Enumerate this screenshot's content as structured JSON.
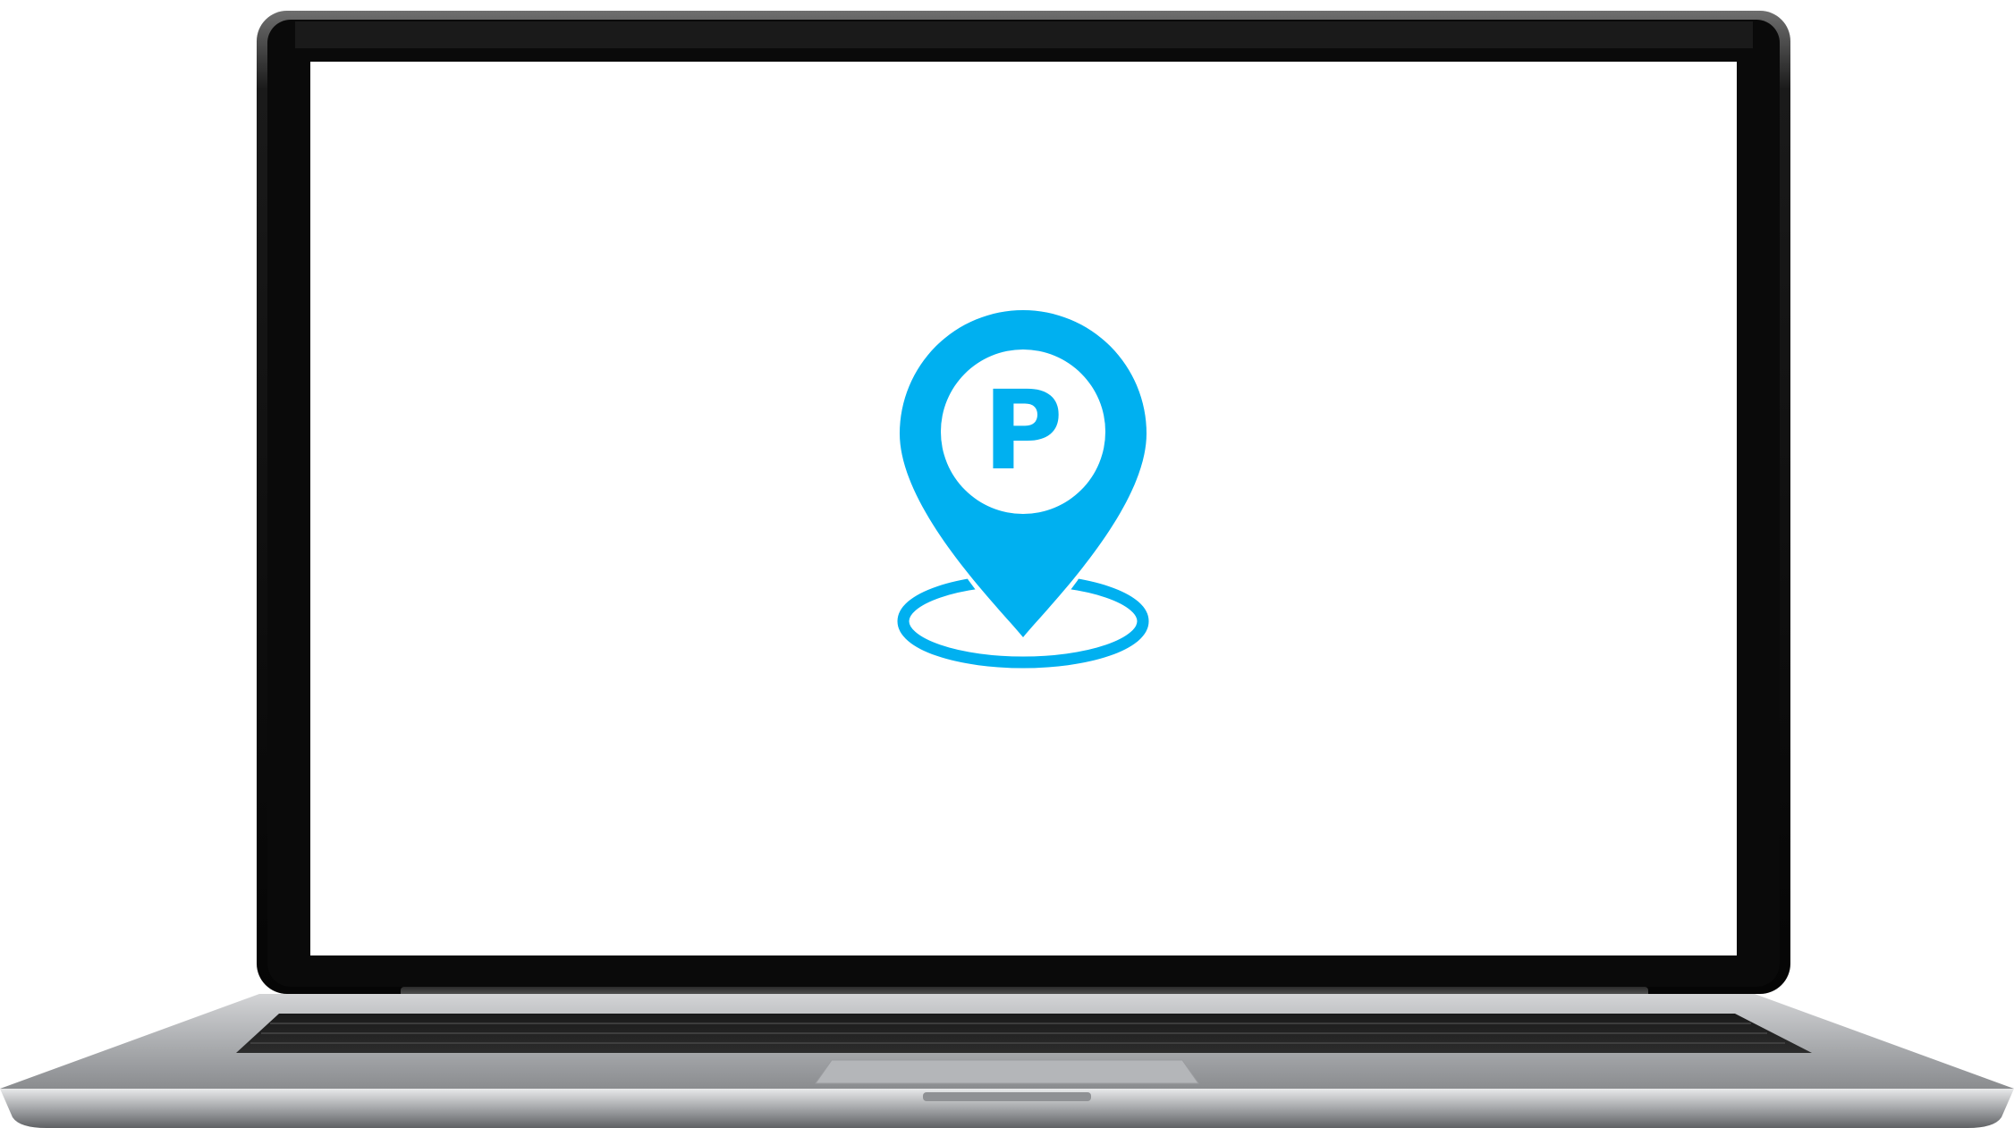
{
  "scene": {
    "device": "laptop",
    "screen_background": "#ffffff",
    "bezel_color": "#0b0b0b",
    "body_color": "#b9bbbe"
  },
  "logo": {
    "icon": "parking-location-pin-icon",
    "letter": "P",
    "color": "#00b0f0"
  }
}
